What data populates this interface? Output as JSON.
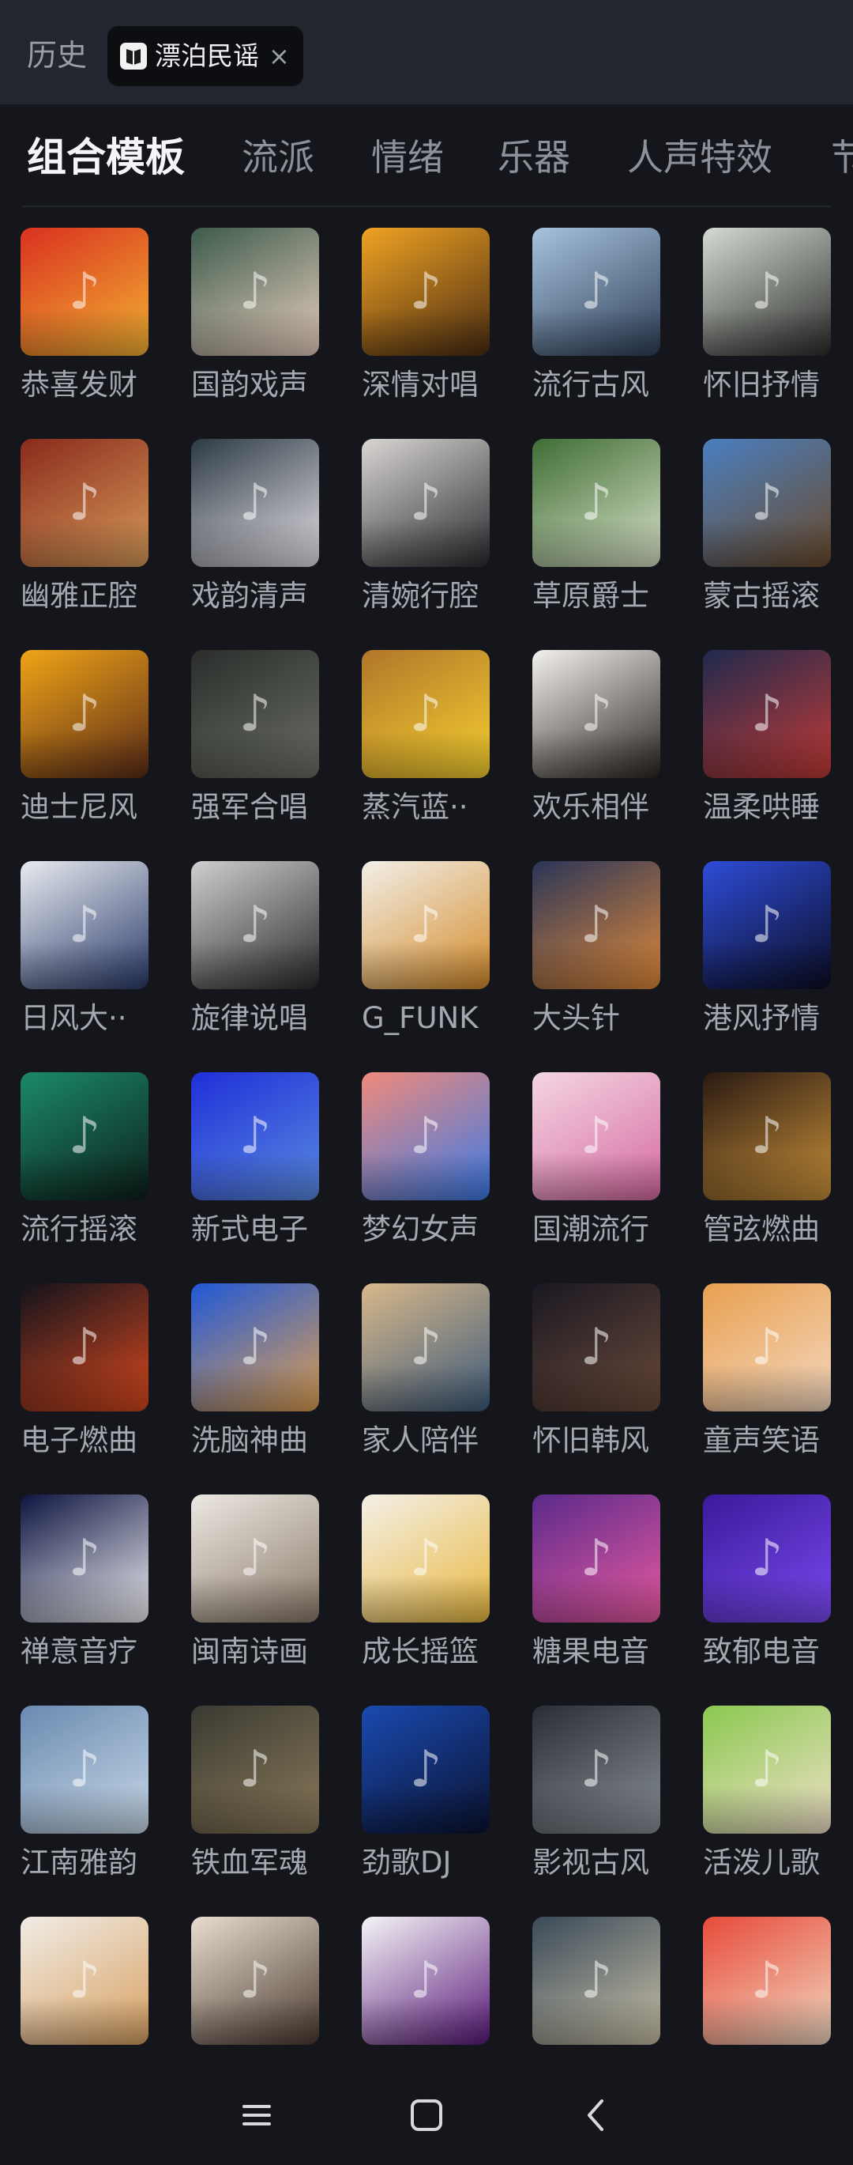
{
  "top": {
    "history_label": "历史",
    "chip": {
      "label": "漂泊民谣",
      "close": "×"
    }
  },
  "tabs": [
    {
      "label": "组合模板",
      "active": true
    },
    {
      "label": "流派",
      "active": false
    },
    {
      "label": "情绪",
      "active": false
    },
    {
      "label": "乐器",
      "active": false
    },
    {
      "label": "人声特效",
      "active": false
    },
    {
      "label": "节",
      "active": false
    }
  ],
  "templates": [
    {
      "label": "恭喜发财",
      "c1": "#d9311f",
      "c2": "#f2b233",
      "icon": "caishen-thumb-icon"
    },
    {
      "label": "国韵戏声",
      "c1": "#3c5a4a",
      "c2": "#e8cfc0",
      "icon": "opera-mask-thumb-icon"
    },
    {
      "label": "深情对唱",
      "c1": "#f0a323",
      "c2": "#4a2c12",
      "icon": "duet-singers-thumb-icon"
    },
    {
      "label": "流行古风",
      "c1": "#a7c3dd",
      "c2": "#2e3e57",
      "icon": "ancient-girl-thumb-icon"
    },
    {
      "label": "怀旧抒情",
      "c1": "#d5dad2",
      "c2": "#2a2c2a",
      "icon": "retro-woman-thumb-icon"
    },
    {
      "label": "幽雅正腔",
      "c1": "#8a2a1c",
      "c2": "#d79b5a",
      "icon": "opera-lady-thumb-icon"
    },
    {
      "label": "戏韵清声",
      "c1": "#2c3a44",
      "c2": "#e7e2e8",
      "icon": "opera-headdress-thumb-icon"
    },
    {
      "label": "清婉行腔",
      "c1": "#d9d6d4",
      "c2": "#2b2b2e",
      "icon": "fan-opera-thumb-icon"
    },
    {
      "label": "草原爵士",
      "c1": "#3f6d35",
      "c2": "#d9e2c8",
      "icon": "grassland-thumb-icon"
    },
    {
      "label": "蒙古摇滚",
      "c1": "#4a7fc0",
      "c2": "#6a4a2a",
      "icon": "mongol-thumb-icon"
    },
    {
      "label": "迪士尼风",
      "c1": "#f0a417",
      "c2": "#5b2c18",
      "icon": "cartoon-girl-thumb-icon"
    },
    {
      "label": "强军合唱",
      "c1": "#2a2d2a",
      "c2": "#6b6f66",
      "icon": "choir-thumb-icon"
    },
    {
      "label": "蒸汽蓝··",
      "c1": "#b0762a",
      "c2": "#f5d030",
      "icon": "yellow-hoodie-thumb-icon"
    },
    {
      "label": "欢乐相伴",
      "c1": "#f4f2ee",
      "c2": "#2a2522",
      "icon": "happy-kids-thumb-icon"
    },
    {
      "label": "温柔哄睡",
      "c1": "#1f2a4d",
      "c2": "#c23a36",
      "icon": "sleeping-child-thumb-icon"
    },
    {
      "label": "日风大··",
      "c1": "#e8ebf0",
      "c2": "#2a3a6a",
      "icon": "anime-band-thumb-icon"
    },
    {
      "label": "旋律说唱",
      "c1": "#cfcfcf",
      "c2": "#2a2a2a",
      "icon": "rapper-thumb-icon"
    },
    {
      "label": "G_FUNK",
      "c1": "#f2efe8",
      "c2": "#d38b2a",
      "icon": "boombox-thumb-icon"
    },
    {
      "label": "大头针",
      "c1": "#2a3558",
      "c2": "#e08a3a",
      "icon": "piano-scene-thumb-icon"
    },
    {
      "label": "港风抒情",
      "c1": "#2e4cd8",
      "c2": "#0b0d22",
      "icon": "silhouette-thumb-icon"
    },
    {
      "label": "流行摇滚",
      "c1": "#1b8a6a",
      "c2": "#0d1e1a",
      "icon": "guitarist-thumb-icon"
    },
    {
      "label": "新式电子",
      "c1": "#1f2fd8",
      "c2": "#5a8ae0",
      "icon": "pixel-face-thumb-icon"
    },
    {
      "label": "梦幻女声",
      "c1": "#f08a7a",
      "c2": "#3a7ae8",
      "icon": "dream-girl-thumb-icon"
    },
    {
      "label": "国潮流行",
      "c1": "#f4d6e2",
      "c2": "#d56aa0",
      "icon": "anime-pink-thumb-icon"
    },
    {
      "label": "管弦燃曲",
      "c1": "#2a1a12",
      "c2": "#c8903a",
      "icon": "saxophone-thumb-icon"
    },
    {
      "label": "电子燃曲",
      "c1": "#12131c",
      "c2": "#d8481e",
      "icon": "fire-ring-thumb-icon"
    },
    {
      "label": "洗脑神曲",
      "c1": "#1f58d8",
      "c2": "#e0a050",
      "icon": "dj-lady-thumb-icon"
    },
    {
      "label": "家人陪伴",
      "c1": "#d8b88a",
      "c2": "#3e5a7a",
      "icon": "family-thumb-icon"
    },
    {
      "label": "怀旧韩风",
      "c1": "#1a1822",
      "c2": "#6a4a3a",
      "icon": "couple-thumb-icon"
    },
    {
      "label": "童声笑语",
      "c1": "#e8a050",
      "c2": "#f4d8c0",
      "icon": "smiling-child-thumb-icon"
    },
    {
      "label": "禅意音疗",
      "c1": "#0d1440",
      "c2": "#f0f0f4",
      "icon": "moon-meditation-thumb-icon"
    },
    {
      "label": "闽南诗画",
      "c1": "#ece8e2",
      "c2": "#8a7a6a",
      "icon": "elder-sketch-thumb-icon"
    },
    {
      "label": "成长摇篮",
      "c1": "#f4f0e8",
      "c2": "#e8b840",
      "icon": "boy-beanie-thumb-icon"
    },
    {
      "label": "糖果电音",
      "c1": "#5a2a8a",
      "c2": "#e85aa0",
      "icon": "cocktail-thumb-icon"
    },
    {
      "label": "致郁电音",
      "c1": "#3a1a9a",
      "c2": "#7a4af0",
      "icon": "headphone-girl-thumb-icon"
    },
    {
      "label": "江南雅韵",
      "c1": "#6a8ab0",
      "c2": "#c8d8e8",
      "icon": "bell-thumb-icon"
    },
    {
      "label": "铁血军魂",
      "c1": "#3a3a32",
      "c2": "#8a7a5a",
      "icon": "soldier-thumb-icon"
    },
    {
      "label": "劲歌DJ",
      "c1": "#1a4ab0",
      "c2": "#0a1230",
      "icon": "dj-silhouette-thumb-icon"
    },
    {
      "label": "影视古风",
      "c1": "#2a2e34",
      "c2": "#8a9098",
      "icon": "swordsman-thumb-icon"
    },
    {
      "label": "活泼儿歌",
      "c1": "#8ac850",
      "c2": "#f0e0c8",
      "icon": "child-orange-thumb-icon"
    },
    {
      "label": "",
      "c1": "#f0ece6",
      "c2": "#d8a060",
      "icon": "birthday-cake-thumb-icon"
    },
    {
      "label": "",
      "c1": "#e8ddd0",
      "c2": "#4a3a30",
      "icon": "ancient-lady-thumb-icon"
    },
    {
      "label": "",
      "c1": "#f4f4f6",
      "c2": "#5a1a7a",
      "icon": "purple-urchin-thumb-icon"
    },
    {
      "label": "",
      "c1": "#3a4a58",
      "c2": "#c8c0a8",
      "icon": "valley-river-thumb-icon"
    },
    {
      "label": "",
      "c1": "#e84a3a",
      "c2": "#f0d8c0",
      "icon": "cartoon-boy-thumb-icon"
    }
  ],
  "navbar": {
    "menu_icon": "menu-icon",
    "home_icon": "home-icon",
    "back_icon": "back-icon"
  }
}
